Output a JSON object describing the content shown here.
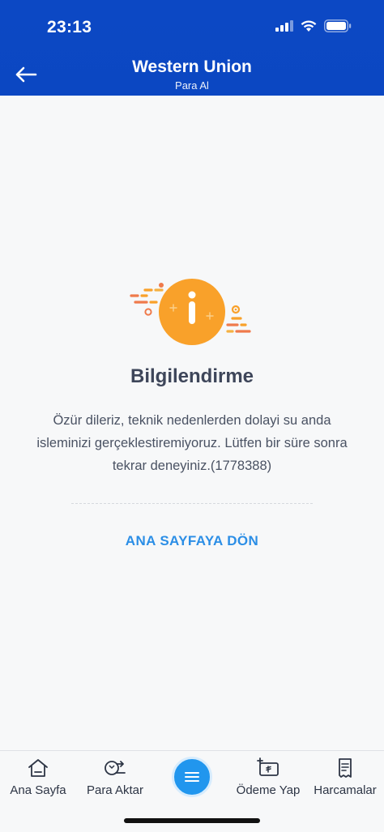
{
  "status_bar": {
    "time": "23:13"
  },
  "header": {
    "title": "Western Union",
    "subtitle": "Para Al"
  },
  "info": {
    "heading": "Bilgilendirme",
    "message": "Özür dileriz, teknik nedenlerden dolayi su anda isleminizi gerçeklestiremiyoruz. Lütfen bir süre sonra tekrar deneyiniz.(1778388)",
    "home_link": "ANA SAYFAYA DÖN"
  },
  "tabbar": {
    "items": [
      {
        "label": "Ana Sayfa",
        "icon": "home-icon"
      },
      {
        "label": "Para Aktar",
        "icon": "money-transfer-icon"
      },
      {
        "label": "",
        "icon": "menu-icon"
      },
      {
        "label": "Ödeme Yap",
        "icon": "payment-icon"
      },
      {
        "label": "Harcamalar",
        "icon": "receipt-icon"
      }
    ]
  },
  "colors": {
    "header_bg": "#0b47c2",
    "accent_orange": "#f9a12a",
    "link_blue": "#2b8ee6",
    "menu_button": "#2196ee"
  }
}
